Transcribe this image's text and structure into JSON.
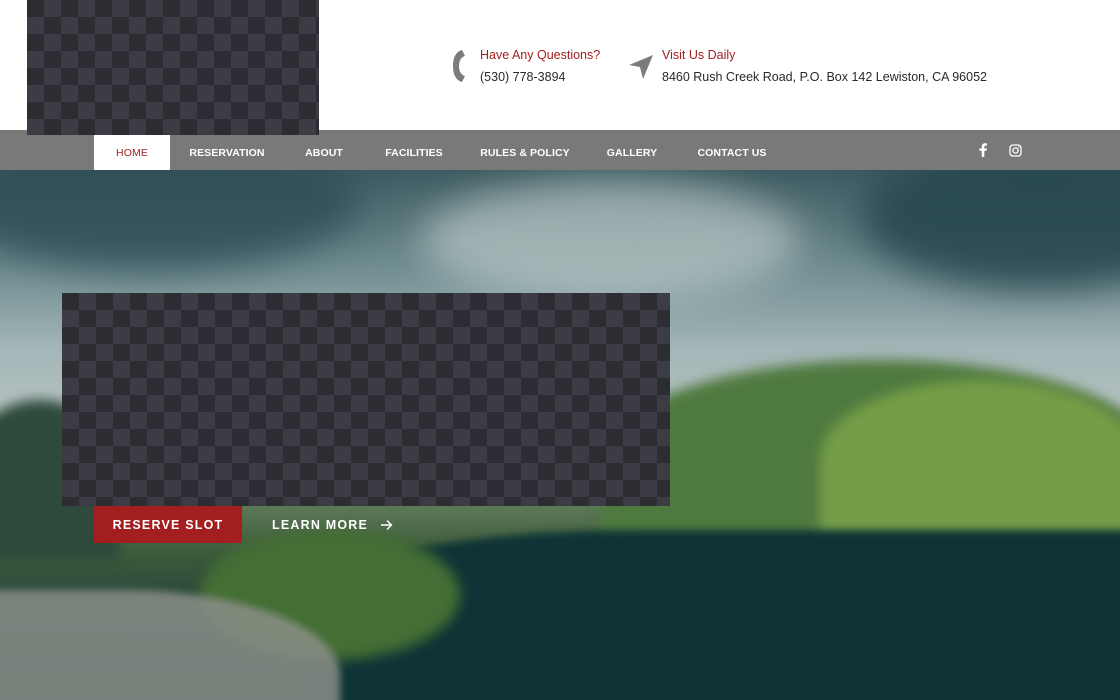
{
  "header": {
    "logo_alt": "",
    "phone": {
      "heading": "Have Any Questions?",
      "value": "(530) 778-3894",
      "icon": "phone-icon"
    },
    "visit": {
      "heading": "Visit Us Daily",
      "value": "8460 Rush Creek Road, P.O. Box 142 Lewiston, CA 96052",
      "icon": "location-arrow-icon"
    }
  },
  "nav": {
    "items": [
      {
        "label": "HOME",
        "active": true
      },
      {
        "label": "RESERVATION",
        "active": false
      },
      {
        "label": "ABOUT",
        "active": false
      },
      {
        "label": "FACILITIES",
        "active": false
      },
      {
        "label": "RULES & POLICY",
        "active": false
      },
      {
        "label": "GALLERY",
        "active": false
      },
      {
        "label": "CONTACT US",
        "active": false
      }
    ],
    "social": [
      {
        "name": "facebook-icon"
      },
      {
        "name": "instagram-icon"
      }
    ]
  },
  "hero": {
    "primary_button": "RESERVE SLOT",
    "secondary_button": "LEARN MORE",
    "secondary_icon": "arrow-right-icon"
  },
  "colors": {
    "accent": "#a31f1f",
    "nav_background": "#787a78",
    "text_dark": "#27292e"
  }
}
